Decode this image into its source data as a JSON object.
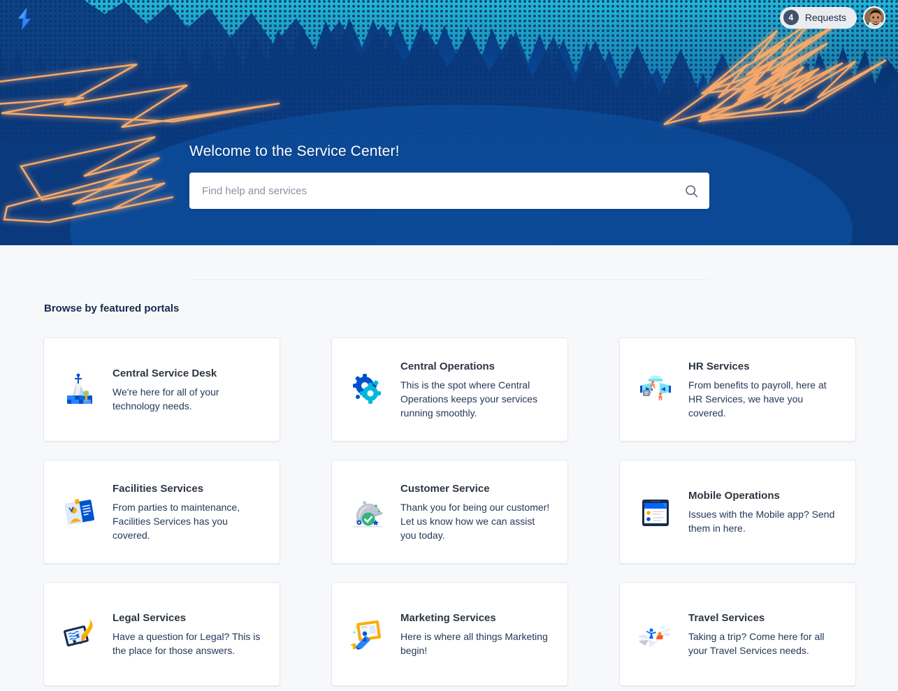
{
  "brand": {
    "logo_icon": "lightning-bolt-logo",
    "accent_blue": "#0052cc",
    "hero_blue_dark": "#062f68",
    "hero_blue_mid": "#0a4da0",
    "halftone_cyan": "#22b8d6",
    "lightning_orange": "#f6a96b"
  },
  "topbar": {
    "requests_count": "4",
    "requests_label": "Requests",
    "avatar_name": "user-avatar"
  },
  "hero": {
    "title": "Welcome to the Service Center!",
    "search": {
      "value": "",
      "placeholder": "Find help and services",
      "icon": "search-icon"
    }
  },
  "main": {
    "section_title": "Browse by featured portals",
    "portals": [
      {
        "title": "Central Service Desk",
        "description": "We're here for all of your technology needs.",
        "icon": "iceberg-service-desk-icon"
      },
      {
        "title": "Central Operations",
        "description": "This is the spot where Central Operations keeps your services running smoothly.",
        "icon": "gears-operations-icon"
      },
      {
        "title": "HR Services",
        "description": "From benefits to payroll, here at HR Services, we have you covered.",
        "icon": "people-hr-icon"
      },
      {
        "title": "Facilities Services",
        "description": "From parties to maintenance, Facilities Services has you covered.",
        "icon": "badge-facilities-icon"
      },
      {
        "title": "Customer Service",
        "description": "Thank you for being our customer! Let us know how we can assist you today.",
        "icon": "cloche-check-customer-icon"
      },
      {
        "title": "Mobile Operations",
        "description": "Issues with the Mobile app? Send them in here.",
        "icon": "tablet-mobile-icon"
      },
      {
        "title": "Legal Services",
        "description": "Have a question for Legal? This is the place for those answers.",
        "icon": "tablet-pencil-legal-icon"
      },
      {
        "title": "Marketing Services",
        "description": "Here is where all things Marketing begin!",
        "icon": "presentation-marketing-icon"
      },
      {
        "title": "Travel Services",
        "description": "Taking a trip? Come here for all your Travel Services needs.",
        "icon": "paper-plane-travel-icon"
      }
    ]
  }
}
